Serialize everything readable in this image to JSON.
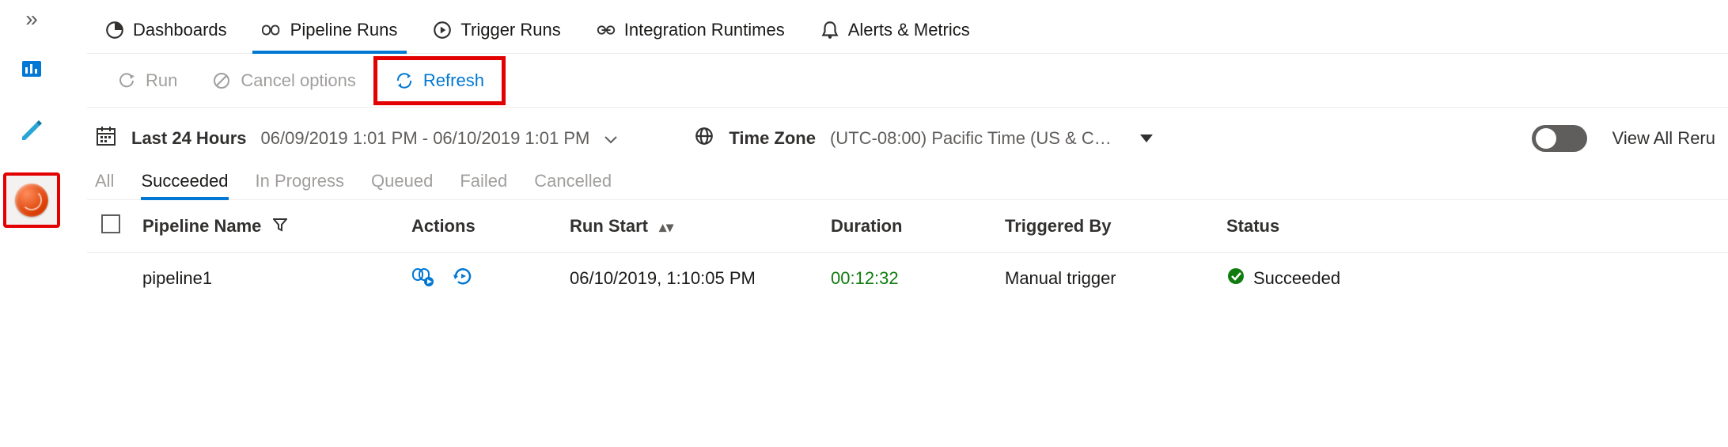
{
  "rail": {
    "expand_glyph": "»"
  },
  "topnav": [
    {
      "label": "Dashboards"
    },
    {
      "label": "Pipeline Runs"
    },
    {
      "label": "Trigger Runs"
    },
    {
      "label": "Integration Runtimes"
    },
    {
      "label": "Alerts & Metrics"
    }
  ],
  "toolbar": {
    "run_label": "Run",
    "cancel_label": "Cancel options",
    "refresh_label": "Refresh"
  },
  "filter": {
    "range_label": "Last 24 Hours",
    "range_value": "06/09/2019 1:01 PM - 06/10/2019 1:01 PM",
    "tz_label": "Time Zone",
    "tz_value": "(UTC-08:00) Pacific Time (US & Ca...",
    "view_all_label": "View All Reru"
  },
  "status_tabs": [
    "All",
    "Succeeded",
    "In Progress",
    "Queued",
    "Failed",
    "Cancelled"
  ],
  "columns": {
    "name": "Pipeline Name",
    "actions": "Actions",
    "start": "Run Start",
    "duration": "Duration",
    "triggered": "Triggered By",
    "status": "Status"
  },
  "rows": [
    {
      "name": "pipeline1",
      "start": "06/10/2019, 1:10:05 PM",
      "duration": "00:12:32",
      "triggered": "Manual trigger",
      "status": "Succeeded"
    }
  ]
}
